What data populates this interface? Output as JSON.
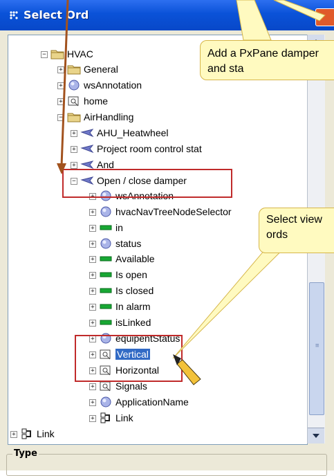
{
  "window": {
    "title": "Select Ord"
  },
  "tree": {
    "rows": [
      {
        "label": "HVAC",
        "icon": "folder-icon",
        "expander": "−",
        "selected": false
      },
      {
        "label": "General",
        "icon": "folder-icon",
        "expander": "+",
        "selected": false
      },
      {
        "label": "wsAnnotation",
        "icon": "circle-icon",
        "expander": "+",
        "selected": false
      },
      {
        "label": "home",
        "icon": "px-view-icon",
        "expander": "+",
        "selected": false
      },
      {
        "label": "AirHandling",
        "icon": "folder-icon",
        "expander": "−",
        "selected": false
      },
      {
        "label": "AHU_Heatwheel",
        "icon": "component-icon",
        "expander": "+",
        "selected": false
      },
      {
        "label": "Project room control stat",
        "icon": "component-icon",
        "expander": "+",
        "selected": false
      },
      {
        "label": "And",
        "icon": "component-icon",
        "expander": "+",
        "selected": false
      },
      {
        "label": "Open / close damper",
        "icon": "component-icon",
        "expander": "−",
        "selected": false
      },
      {
        "label": "wsAnnotation",
        "icon": "circle-icon",
        "expander": "+",
        "selected": false
      },
      {
        "label": "hvacNavTreeNodeSelector",
        "icon": "circle-icon",
        "expander": "+",
        "selected": false
      },
      {
        "label": "in",
        "icon": "point-icon",
        "expander": "+",
        "selected": false
      },
      {
        "label": "status",
        "icon": "circle-icon",
        "expander": "+",
        "selected": false
      },
      {
        "label": "Available",
        "icon": "point-icon",
        "expander": "+",
        "selected": false
      },
      {
        "label": "Is open",
        "icon": "point-icon",
        "expander": "+",
        "selected": false
      },
      {
        "label": "Is closed",
        "icon": "point-icon",
        "expander": "+",
        "selected": false
      },
      {
        "label": "In alarm",
        "icon": "point-icon",
        "expander": "+",
        "selected": false
      },
      {
        "label": "isLinked",
        "icon": "point-icon",
        "expander": "+",
        "selected": false
      },
      {
        "label": "equipentStatus",
        "icon": "circle-icon",
        "expander": "+",
        "selected": false
      },
      {
        "label": "Vertical",
        "icon": "px-view-icon",
        "expander": "+",
        "selected": true
      },
      {
        "label": "Horizontal",
        "icon": "px-view-icon",
        "expander": "+",
        "selected": false
      },
      {
        "label": "Signals",
        "icon": "px-view-icon",
        "expander": "+",
        "selected": false
      },
      {
        "label": "ApplicationName",
        "icon": "circle-icon",
        "expander": "+",
        "selected": false
      },
      {
        "label": "Link",
        "icon": "link-icon",
        "expander": "+",
        "selected": false
      },
      {
        "label": "Link",
        "icon": "link-icon",
        "expander": "+",
        "selected": false
      }
    ]
  },
  "type_section": {
    "label": "Type"
  },
  "callouts": {
    "top": "Add a PxPane damper and sta",
    "select": "Select view ords"
  },
  "colors": {
    "titlebar": "#0a52d8",
    "selection": "#316ac5",
    "annotation_red": "#c02a2a",
    "callout_fill": "#fffac0",
    "arrow_brown": "#a2521e"
  }
}
